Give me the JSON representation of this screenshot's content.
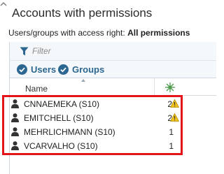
{
  "header": {
    "title": "Accounts with permissions",
    "subtitle_prefix": "Users/groups with access right: ",
    "subtitle_value": "All permissions"
  },
  "filter": {
    "placeholder": "Filter"
  },
  "toggles": {
    "users_label": "Users",
    "groups_label": "Groups"
  },
  "table": {
    "name_header": "Name",
    "rows": [
      {
        "name": "CNNAEMEKA (S10)",
        "count": "2",
        "warning": true
      },
      {
        "name": "EMITCHELL (S10)",
        "count": "2",
        "warning": true
      },
      {
        "name": "MEHRLICHMANN (S10)",
        "count": "1",
        "warning": false
      },
      {
        "name": "VCARVALHO (S10)",
        "count": "1",
        "warning": false
      }
    ]
  },
  "colors": {
    "accent": "#2c6791",
    "highlight": "#e4141b",
    "warning": "#f2c31b"
  },
  "icons": {
    "filter": "filter-icon",
    "check": "check-circle-icon",
    "person": "person-icon",
    "warning": "warning-icon",
    "permissions_column": "permissions-column-icon"
  }
}
